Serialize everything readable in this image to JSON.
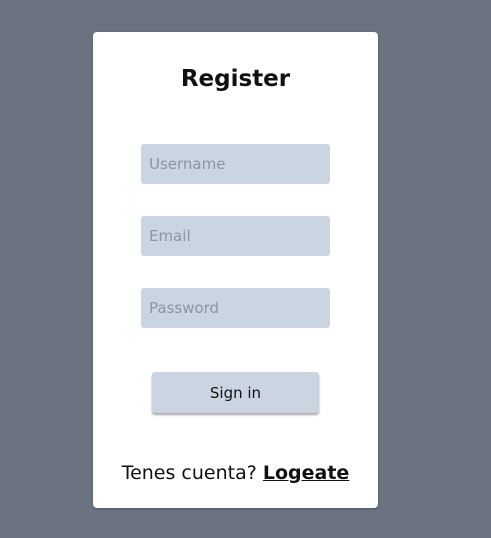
{
  "form": {
    "title": "Register",
    "username": {
      "placeholder": "Username",
      "value": ""
    },
    "email": {
      "placeholder": "Email",
      "value": ""
    },
    "password": {
      "placeholder": "Password",
      "value": ""
    },
    "submit_label": "Sign in",
    "footer_text": "Tenes cuenta?",
    "footer_link": "Logeate"
  }
}
